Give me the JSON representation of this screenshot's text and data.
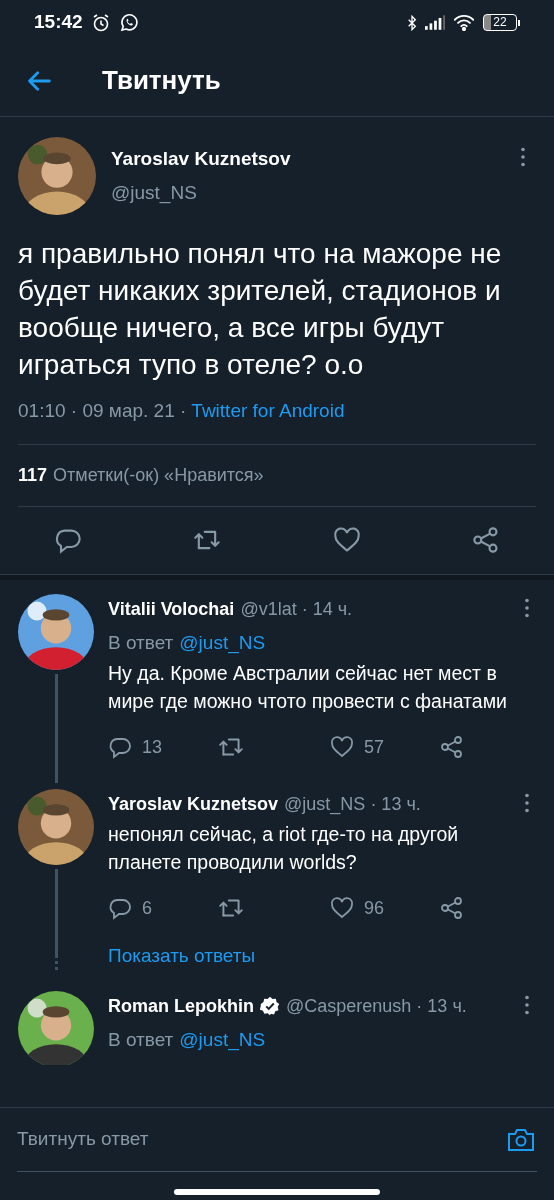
{
  "status_bar": {
    "time": "15:42",
    "battery": "22"
  },
  "header": {
    "title": "Твитнуть"
  },
  "tweet": {
    "author": "Yaroslav Kuznetsov",
    "handle": "@just_NS",
    "text": "я правильно понял что на мажоре не будет никаких зрителей, стадионов и вообще ничего, а все игры будут играться тупо в отеле? о.о",
    "date": "01:10 · 09 мар. 21 ·",
    "source": "Twitter for Android",
    "likes_count": "117",
    "likes_label": "Отметки(-ок) «Нравится»"
  },
  "replies": [
    {
      "author": "Vitalii Volochai",
      "verified": false,
      "meta": "@v1lat · 14 ч.",
      "reply_prefix": "В ответ",
      "reply_to": "@just_NS",
      "text": "Ну да. Кроме Австралии сейчас нет мест в мире где можно чтото провести с фанатами",
      "reply_count": "13",
      "like_count": "57",
      "connected": true
    },
    {
      "author": "Yaroslav Kuznetsov",
      "verified": false,
      "meta": "@just_NS · 13 ч.",
      "text": "непонял сейчас, а riot где-то на другой планете проводили worlds?",
      "reply_count": "6",
      "like_count": "96",
      "connected": true,
      "show_replies": "Показать ответы"
    },
    {
      "author": "Roman Lepokhin",
      "verified": true,
      "meta": "@Casperenush · 13 ч.",
      "reply_prefix": "В ответ",
      "reply_to": "@just_NS"
    }
  ],
  "composer": {
    "placeholder": "Твитнуть ответ"
  }
}
